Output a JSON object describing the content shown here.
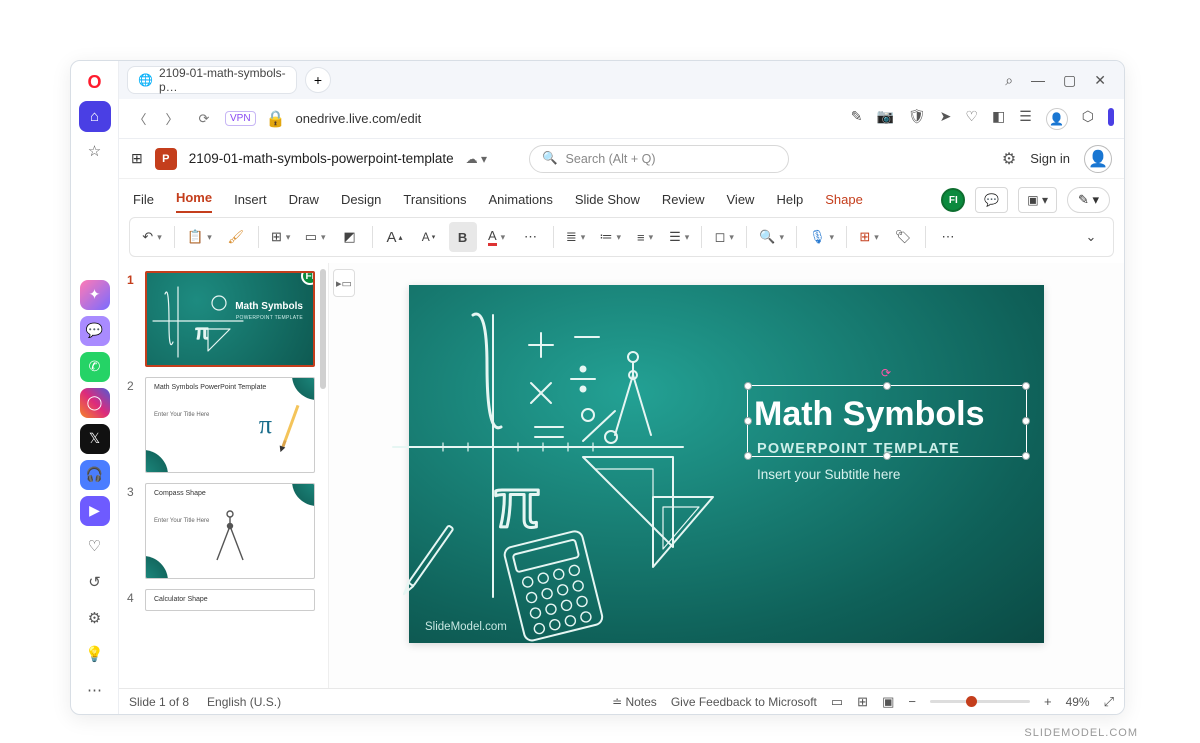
{
  "browser": {
    "tab_title": "2109-01-math-symbols-p…",
    "url": "onedrive.live.com/edit",
    "vpn_label": "VPN"
  },
  "app": {
    "doc_title": "2109-01-math-symbols-powerpoint-template",
    "search_placeholder": "Search (Alt + Q)",
    "sign_in": "Sign in"
  },
  "ribbon_tabs": {
    "file": "File",
    "home": "Home",
    "insert": "Insert",
    "draw": "Draw",
    "design": "Design",
    "transitions": "Transitions",
    "animations": "Animations",
    "slideshow": "Slide Show",
    "review": "Review",
    "view": "View",
    "help": "Help",
    "shape": "Shape"
  },
  "presence_initials": "FI",
  "ribbon_icons": {
    "undo": "↶",
    "paste": "📋",
    "format_painter": "✎",
    "new_slide": "⊞",
    "layout": "▭",
    "picture": "🖼",
    "grow": "A",
    "shrink": "A",
    "bold": "B",
    "font_color": "A",
    "more1": "⋯",
    "bullets": "≣",
    "numbering": "≔",
    "line_spacing": "≡",
    "align": "≣",
    "shapes": "◻",
    "find": "🔍",
    "dictate": "🎙",
    "designer": "⊞",
    "sensitivity": "🏷",
    "more2": "⋯"
  },
  "thumbs": [
    {
      "n": "1",
      "title": "Math Symbols",
      "sub": "POWERPOINT TEMPLATE"
    },
    {
      "n": "2",
      "title": "Math Symbols PowerPoint Template",
      "body": "Enter Your Title Here"
    },
    {
      "n": "3",
      "title": "Compass Shape",
      "body": "Enter Your Title Here"
    },
    {
      "n": "4",
      "title": "Calculator Shape"
    }
  ],
  "slide": {
    "title": "Math Symbols",
    "subtitle": "POWERPOINT TEMPLATE",
    "subtitle2": "Insert your Subtitle here",
    "watermark": "SlideModel.com"
  },
  "status": {
    "slide_pos": "Slide 1 of 8",
    "lang": "English (U.S.)",
    "notes": "Notes",
    "feedback": "Give Feedback to Microsoft",
    "zoom": "49%"
  },
  "footer_brand": "SLIDEMODEL.COM"
}
